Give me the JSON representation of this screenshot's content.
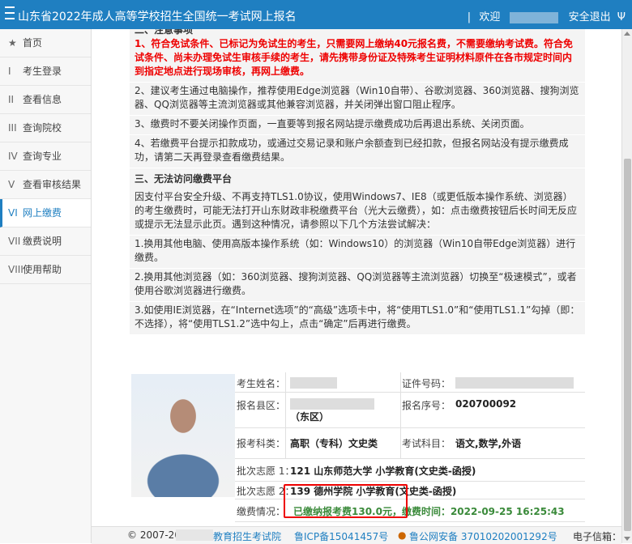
{
  "header": {
    "title": "山东省2022年成人高等学校招生全国统一考试网上报名",
    "separator": "|",
    "welcome": "欢迎",
    "logout": "安全退出"
  },
  "sidebar": {
    "items": [
      {
        "num": "★",
        "label": "首页"
      },
      {
        "num": "I",
        "label": "考生登录"
      },
      {
        "num": "II",
        "label": "查看信息"
      },
      {
        "num": "III",
        "label": "查询院校"
      },
      {
        "num": "IV",
        "label": "查询专业"
      },
      {
        "num": "V",
        "label": "查看审核结果"
      },
      {
        "num": "VI",
        "label": "网上缴费"
      },
      {
        "num": "VII",
        "label": "缴费说明"
      },
      {
        "num": "VIII",
        "label": "使用帮助"
      }
    ]
  },
  "notice": {
    "partial_heading": "二、注意事项",
    "p1": "1、符合免试条件、已标记为免试生的考生，只需要网上缴纳40元报名费，不需要缴纳考试费。符合免试条件、尚未办理免试生审核手续的考生，请先携带身份证及特殊考生证明材料原件在各市规定时间内到指定地点进行现场审核，再网上缴费。",
    "p2": "2、建议考生通过电脑操作，推荐使用Edge浏览器（Win10自带）、谷歌浏览器、360浏览器、搜狗浏览器、QQ浏览器等主流浏览器或其他兼容浏览器，并关闭弹出窗口阻止程序。",
    "p3": "3、缴费时不要关闭操作页面，一直要等到报名网站提示缴费成功后再退出系统、关闭页面。",
    "p4": "4、若缴费平台提示扣款成功，或通过交易记录和账户余额查到已经扣款，但报名网站没有提示缴费成功，请第二天再登录查看缴费结果。",
    "section3": "三、无法访问缴费平台",
    "p5": "因支付平台安全升级、不再支持TLS1.0协议，使用Windows7、IE8（或更低版本操作系统、浏览器）的考生缴费时，可能无法打开山东财政非税缴费平台（光大云缴费），如：点击缴费按钮后长时间无反应或提示无法显示此页。遇到这种情况，请参照以下几个方法尝试解决：",
    "p6": "1.换用其他电脑、使用高版本操作系统（如：Windows10）的浏览器（Win10自带Edge浏览器）进行缴费。",
    "p7": "2.换用其他浏览器（如：360浏览器、搜狗浏览器、QQ浏览器等主流浏览器）切换至“极速模式”，或者使用谷歌浏览器进行缴费。",
    "p8": "3.如使用IE浏览器，在“Internet选项”的“高级”选项卡中，将“使用TLS1.0”和“使用TLS1.1”勾掉（即：不选择），将“使用TLS1.2”选中勾上，点击“确定”后再进行缴费。"
  },
  "info": {
    "name_label": "考生姓名：",
    "id_label": "证件号码：",
    "county_label": "报名县区：",
    "county_value_tail": "（东区）",
    "regno_label": "报名序号：",
    "regno_value": "020700092",
    "subject_cat_label": "报考科类：",
    "subject_cat_value": "高职（专科）文史类",
    "exam_subjects_label": "考试科目：",
    "exam_subjects_value": "语文,数学,外语",
    "choice1_label": "批次志愿 1：",
    "choice1_value": "121 山东师范大学 小学教育(文史类-函授)",
    "choice2_label": "批次志愿 2：",
    "choice2_value": "139 德州学院 小学教育(文史类-函授)",
    "payment_label": "缴费情况：",
    "payment_value": "已缴纳报考费130.0元，缴费时间：2022-09-25 16:25:43"
  },
  "footer": {
    "copyright": "© 2007-20",
    "site": "教育招生考试院",
    "icp": "鲁ICP备15041457号",
    "police": "鲁公网安备 37010202001292号",
    "email_label": "电子信箱："
  }
}
